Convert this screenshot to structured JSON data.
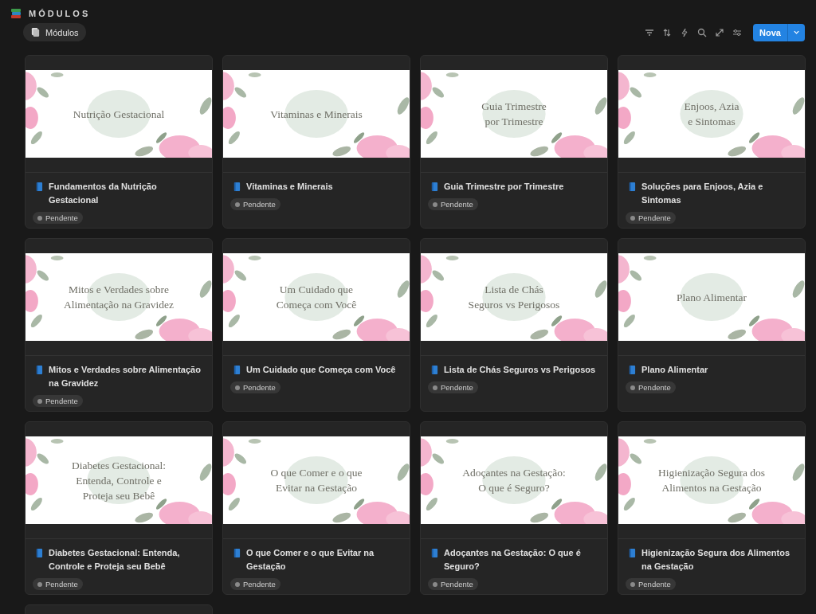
{
  "page": {
    "title": "MÓDULOS"
  },
  "view_tab": {
    "label": "Módulos",
    "selected": true
  },
  "toolbar": {
    "new_button": "Nova"
  },
  "cards": [
    {
      "cover_lines": [
        "Nutrição Gestacional"
      ],
      "title": "Fundamentos da Nutrição Gestacional",
      "status": {
        "label": "Pendente",
        "color": "#8a8a8a"
      }
    },
    {
      "cover_lines": [
        "Vitaminas e Minerais"
      ],
      "title": "Vitaminas e Minerais",
      "status": {
        "label": "Pendente",
        "color": "#8a8a8a"
      }
    },
    {
      "cover_lines": [
        "Guia Trimestre",
        "por Trimestre"
      ],
      "title": "Guia Trimestre por Trimestre",
      "status": {
        "label": "Pendente",
        "color": "#8a8a8a"
      }
    },
    {
      "cover_lines": [
        "Enjoos, Azia",
        "e Sintomas"
      ],
      "title": "Soluções para Enjoos, Azia e Sintomas",
      "status": {
        "label": "Pendente",
        "color": "#8a8a8a"
      }
    },
    {
      "cover_lines": [
        "Mitos e Verdades sobre",
        "Alimentação na Gravidez"
      ],
      "title": "Mitos e Verdades sobre Alimentação na Gravidez",
      "status": {
        "label": "Pendente",
        "color": "#8a8a8a"
      }
    },
    {
      "cover_lines": [
        "Um Cuidado que",
        "Começa com Você"
      ],
      "title": "Um Cuidado que Começa com Você",
      "status": {
        "label": "Pendente",
        "color": "#8a8a8a"
      }
    },
    {
      "cover_lines": [
        "Lista de Chás",
        "Seguros vs Perigosos"
      ],
      "title": "Lista de Chás Seguros vs Perigosos",
      "status": {
        "label": "Pendente",
        "color": "#8a8a8a"
      }
    },
    {
      "cover_lines": [
        "Plano Alimentar"
      ],
      "title": "Plano Alimentar",
      "status": {
        "label": "Pendente",
        "color": "#8a8a8a"
      }
    },
    {
      "cover_lines": [
        "Diabetes Gestacional:",
        "Entenda, Controle e",
        "Proteja seu Bebê"
      ],
      "title": "Diabetes Gestacional: Entenda, Controle e Proteja seu Bebê",
      "status": {
        "label": "Pendente",
        "color": "#8a8a8a"
      }
    },
    {
      "cover_lines": [
        "O que Comer e o que",
        "Evitar na Gestação"
      ],
      "title": "O que Comer e o que Evitar na Gestação",
      "status": {
        "label": "Pendente",
        "color": "#8a8a8a"
      }
    },
    {
      "cover_lines": [
        "Adoçantes na Gestação:",
        "O que é Seguro?"
      ],
      "title": "Adoçantes na Gestação: O que é Seguro?",
      "status": {
        "label": "Pendente",
        "color": "#8a8a8a"
      }
    },
    {
      "cover_lines": [
        "Higienização Segura dos",
        "Alimentos na Gestação"
      ],
      "title": "Higienização Segura dos Alimentos na Gestação",
      "status": {
        "label": "Pendente",
        "color": "#8a8a8a"
      }
    }
  ]
}
